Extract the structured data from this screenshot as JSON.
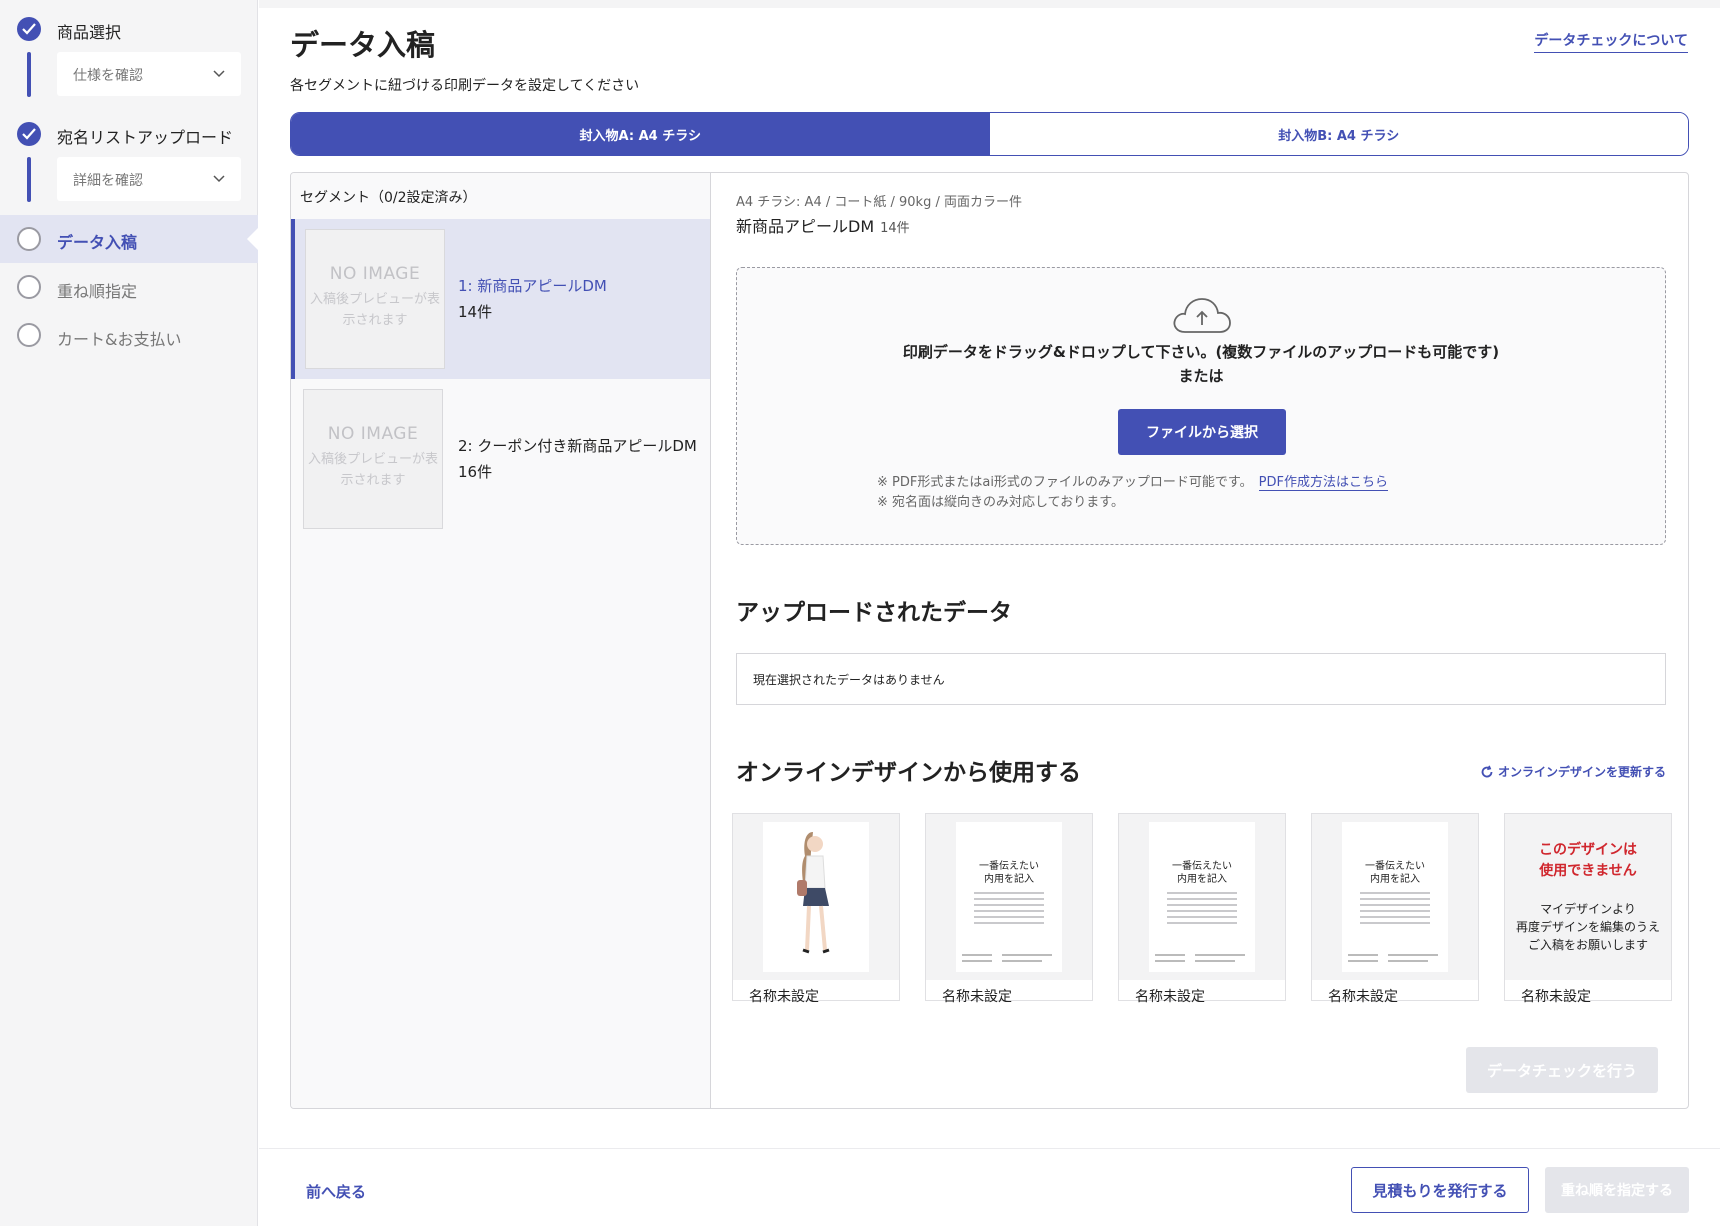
{
  "steps": [
    {
      "label": "商品選択",
      "status": "done"
    },
    {
      "label": "宛名リストアップロード",
      "status": "done"
    },
    {
      "label": "データ入稿",
      "status": "active"
    },
    {
      "label": "重ね順指定",
      "status": "pending"
    },
    {
      "label": "カート&お支払い",
      "status": "pending"
    }
  ],
  "step_selects": {
    "spec": "仕様を確認",
    "details": "詳細を確認"
  },
  "header": {
    "title": "データ入稿",
    "subtitle": "各セグメントに紐づける印刷データを設定してください",
    "check_link": "データチェックについて"
  },
  "tabs": [
    {
      "label": "封入物A: A4 チラシ",
      "active": true
    },
    {
      "label": "封入物B: A4 チラシ",
      "active": false
    }
  ],
  "segments": {
    "header": "セグメント（0/2設定済み）",
    "no_image_title": "NO IMAGE",
    "no_image_sub": "入稿後プレビューが表示されます",
    "items": [
      {
        "name": "1: 新商品アピールDM",
        "count": "14件",
        "selected": true
      },
      {
        "name": "2: クーポン付き新商品アピールDM",
        "count": "16件",
        "selected": false
      }
    ]
  },
  "detail": {
    "spec": "A4 チラシ: A4 / コート紙 / 90kg / 両面カラー件",
    "design_name": "新商品アピールDM",
    "design_count": "14件"
  },
  "dropzone": {
    "main": "印刷データをドラッグ&ドロップして下さい。(複数ファイルのアップロードも可能です)",
    "or": "または",
    "button": "ファイルから選択",
    "note1": "※ PDF形式またはai形式のファイルのみアップロード可能です。",
    "note1_link": "PDF作成方法はこちら",
    "note2": "※ 宛名面は縦向きのみ対応しております。"
  },
  "uploaded": {
    "title": "アップロードされたデータ",
    "empty": "現在選択されたデータはありません"
  },
  "online": {
    "title": "オンラインデザインから使用する",
    "refresh": "オンラインデザインを更新する",
    "template_heading_1": "一番伝えたい",
    "template_heading_2": "内用を記入",
    "cards": [
      {
        "name": "名称未設定",
        "kind": "photo"
      },
      {
        "name": "名称未設定",
        "kind": "template"
      },
      {
        "name": "名称未設定",
        "kind": "template"
      },
      {
        "name": "名称未設定",
        "kind": "template"
      },
      {
        "name": "名称未設定",
        "kind": "unavailable"
      }
    ],
    "unavailable_title_1": "このデザインは",
    "unavailable_title_2": "使用できません",
    "unavailable_sub_1": "マイデザインより",
    "unavailable_sub_2": "再度デザインを編集のうえ",
    "unavailable_sub_3": "ご入稿をお願いします"
  },
  "check_button": "データチェックを行う",
  "footer": {
    "back": "前へ戻る",
    "quote": "見積もりを発行する",
    "next": "重ね順を指定する"
  },
  "colors": {
    "accent": "#4350b4",
    "error": "#d0272e",
    "disabled": "#e4e5ea"
  }
}
